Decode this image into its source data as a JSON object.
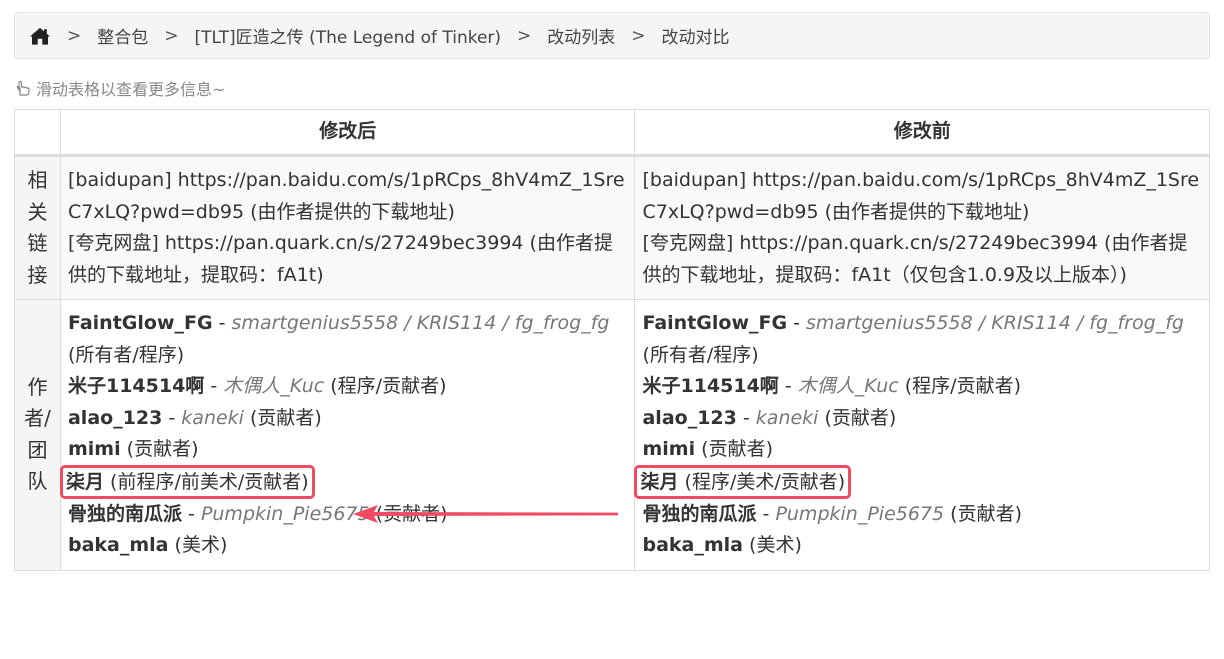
{
  "breadcrumb": {
    "items": [
      "整合包",
      "[TLT]匠造之传 (The Legend of Tinker)",
      "改动列表",
      "改动对比"
    ],
    "separator": ">"
  },
  "hint": "滑动表格以查看更多信息~",
  "table": {
    "headers": {
      "after": "修改后",
      "before": "修改前"
    },
    "rows": {
      "links": {
        "label": "相关链接",
        "after": "[baidupan] https://pan.baidu.com/s/1pRCps_8hV4mZ_1SreC7xLQ?pwd=db95 (由作者提供的下载地址)\n[夸克网盘] https://pan.quark.cn/s/27249bec3994 (由作者提供的下载地址，提取码：fA1t)",
        "before": "[baidupan] https://pan.baidu.com/s/1pRCps_8hV4mZ_1SreC7xLQ?pwd=db95 (由作者提供的下载地址)\n[夸克网盘] https://pan.quark.cn/s/27249bec3994 (由作者提供的下载地址，提取码：fA1t（仅包含1.0.9及以上版本）)"
      },
      "authors": {
        "label": "作者/团队",
        "after": [
          {
            "name": "FaintGlow_FG",
            "alias": "smartgenius5558 / KRIS114 / fg_frog_fg",
            "role": "(所有者/程序)"
          },
          {
            "name": "米子114514啊",
            "alias": "木偶人_Kuc",
            "role": "(程序/贡献者)"
          },
          {
            "name": "alao_123",
            "alias": "kaneki",
            "role": "(贡献者)"
          },
          {
            "name": "mimi",
            "alias": "",
            "role": "(贡献者)"
          },
          {
            "name": "柒月",
            "alias": "",
            "role": "(前程序/前美术/贡献者)",
            "highlight": true
          },
          {
            "name": "骨独的南瓜派",
            "alias": "Pumpkin_Pie5675",
            "role": "(贡献者)"
          },
          {
            "name": "baka_mla",
            "alias": "",
            "role": "(美术)"
          }
        ],
        "before": [
          {
            "name": "FaintGlow_FG",
            "alias": "smartgenius5558 / KRIS114 / fg_frog_fg",
            "role": "(所有者/程序)"
          },
          {
            "name": "米子114514啊",
            "alias": "木偶人_Kuc",
            "role": "(程序/贡献者)"
          },
          {
            "name": "alao_123",
            "alias": "kaneki",
            "role": "(贡献者)"
          },
          {
            "name": "mimi",
            "alias": "",
            "role": "(贡献者)"
          },
          {
            "name": "柒月",
            "alias": "",
            "role": "(程序/美术/贡献者)",
            "highlight": true
          },
          {
            "name": "骨独的南瓜派",
            "alias": "Pumpkin_Pie5675",
            "role": "(贡献者)"
          },
          {
            "name": "baka_mla",
            "alias": "",
            "role": "(美术)"
          }
        ]
      }
    }
  },
  "annotation": {
    "color": "#ef4b63",
    "direction": "before-to-after"
  },
  "icons": {
    "home": "home-icon",
    "hint": "pointing-hand-icon"
  }
}
